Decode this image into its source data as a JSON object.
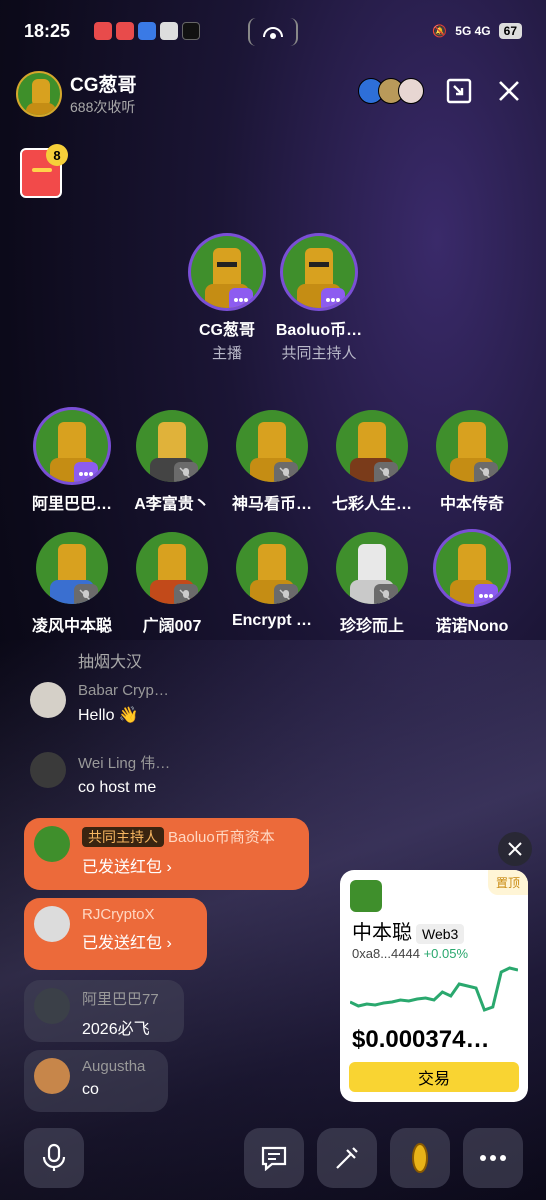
{
  "status_bar": {
    "time": "18:25",
    "network": "5G 4G",
    "battery": "67"
  },
  "host": {
    "name": "CG葱哥",
    "listens": "688次收听"
  },
  "red_packet": {
    "count": "8"
  },
  "speakers_main": [
    {
      "name": "CG葱哥",
      "role": "主播"
    },
    {
      "name": "Baoluo币…",
      "role": "共同主持人"
    }
  ],
  "speakers_grid": [
    {
      "name": "阿里巴巴…"
    },
    {
      "name": "A李富贵丶"
    },
    {
      "name": "神马看币…"
    },
    {
      "name": "七彩人生…"
    },
    {
      "name": "中本传奇"
    },
    {
      "name": "凌风中本聪"
    },
    {
      "name": "广阔007"
    },
    {
      "name": "Encrypt …"
    },
    {
      "name": "珍珍而上"
    },
    {
      "name": "诺诺Nono"
    }
  ],
  "chat": {
    "partial_msg": "抽烟大汉",
    "msg1_user": "Babar Cryp…",
    "msg1_text": "Hello 👋",
    "msg2_user": "Wei Ling 伟…",
    "msg2_text": "co host me",
    "pill1_tag": "共同主持人",
    "pill1_user": "Baoluo币商资本",
    "pill1_text": "已发送红包 ›",
    "pill2_user": "RJCryptoX",
    "pill2_text": "已发送红包 ›",
    "pill3_user": "阿里巴巴77",
    "pill3_text": "2026必飞",
    "pill4_user": "Augustha",
    "pill4_text": "co"
  },
  "trade_card": {
    "pin": "置顶",
    "coin": "中本聪",
    "chain": "Web3",
    "address": "0xa8...4444",
    "change": "+0.05%",
    "price": "$0.000374…",
    "button": "交易",
    "spark": [
      40,
      44,
      42,
      43,
      41,
      40,
      38,
      39,
      37,
      36,
      38,
      30,
      34,
      22,
      24,
      26,
      48,
      45,
      10,
      6,
      8
    ]
  },
  "colors": {
    "accent": "#8d5cf0",
    "orange": "#ec6a3a",
    "up": "#2aa86e",
    "gold": "#f9d432"
  }
}
